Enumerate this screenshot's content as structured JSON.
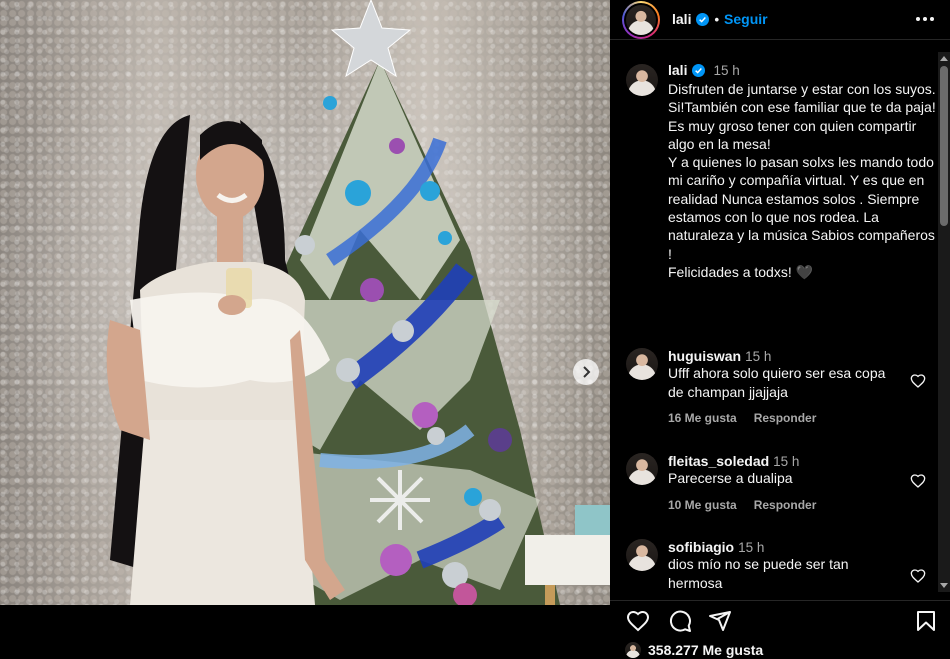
{
  "header": {
    "username": "lali",
    "separator": "•",
    "follow_label": "Seguir"
  },
  "caption": {
    "username": "lali",
    "time": "15 h",
    "text": "Disfruten de juntarse y estar con los suyos.\nSi!También con ese familiar que te da paja!\nEs muy groso tener con quien compartir algo en la mesa!\nY a quienes lo pasan solxs les mando todo mi cariño y compañía virtual. Y es que en realidad Nunca estamos solos . Siempre estamos con lo que nos rodea. La naturaleza y la música Sabios compañeros !\nFelicidades a todxs! 🖤"
  },
  "comments": [
    {
      "username": "huguiswan",
      "time": "15 h",
      "text": "Ufff ahora solo quiero ser esa copa de champan jjajjaja",
      "likes": "16 Me gusta",
      "reply_label": "Responder"
    },
    {
      "username": "fleitas_soledad",
      "time": "15 h",
      "text": "Parecerse a dualipa",
      "likes": "10 Me gusta",
      "reply_label": "Responder"
    },
    {
      "username": "sofibiagio",
      "time": "15 h",
      "text": "dios mío no se puede ser tan hermosa"
    }
  ],
  "footer": {
    "likes_count": "358.277",
    "likes_label": "Me gusta"
  },
  "icons": [
    "verified-icon",
    "more-icon",
    "heart-icon",
    "comment-icon",
    "share-icon",
    "bookmark-icon",
    "next-arrow-icon"
  ],
  "colors": {
    "accent": "#0095f6",
    "background": "#000000",
    "secondary_text": "#a8a8a8"
  }
}
